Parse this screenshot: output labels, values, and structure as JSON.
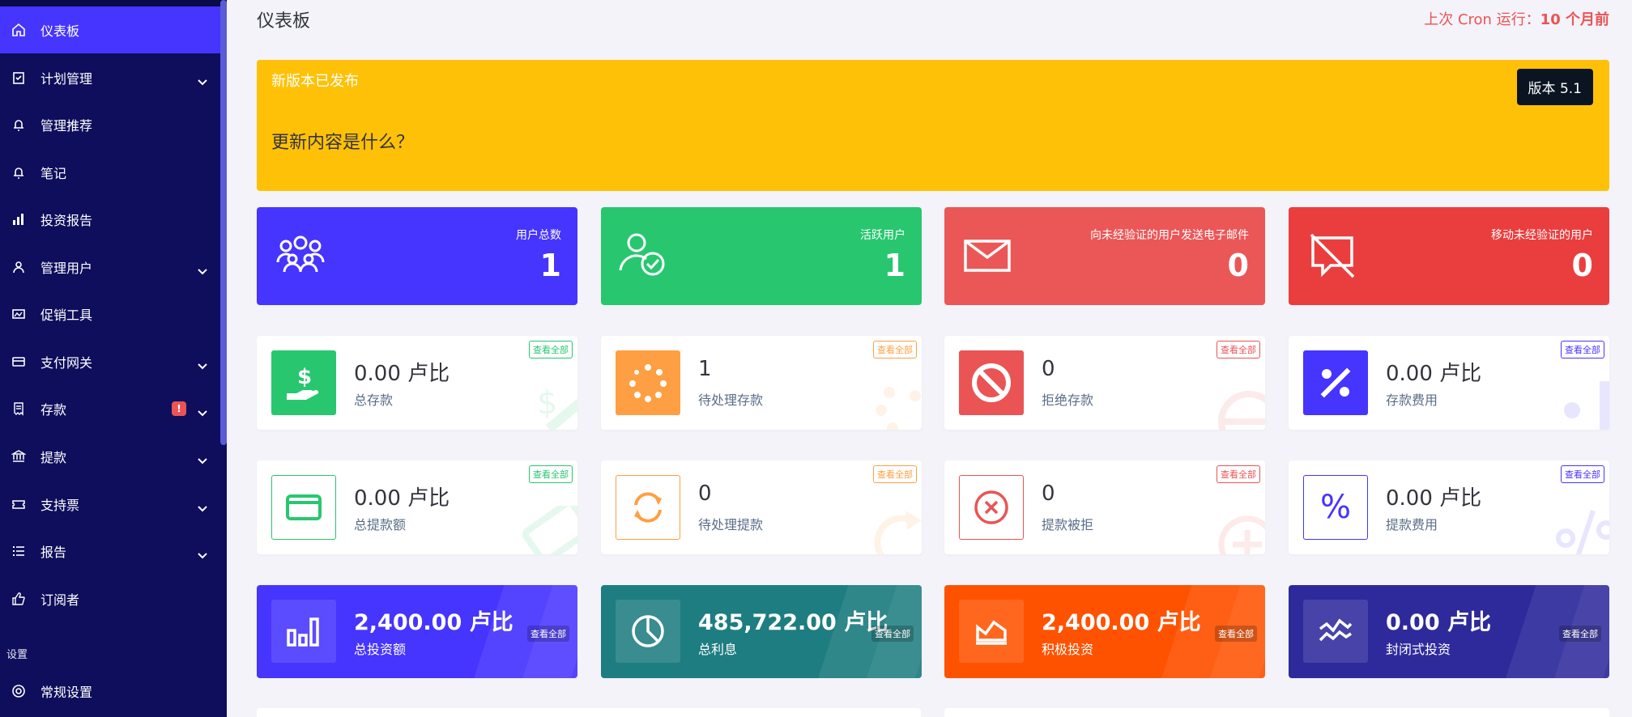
{
  "sidebar": {
    "items": [
      {
        "label": "仪表板",
        "icon": "home-icon",
        "active": true
      },
      {
        "label": "计划管理",
        "icon": "clipboard-icon",
        "chevron": true
      },
      {
        "label": "管理推荐",
        "icon": "bell-icon"
      },
      {
        "label": "笔记",
        "icon": "bell-icon"
      },
      {
        "label": "投资报告",
        "icon": "bar-chart-icon"
      },
      {
        "label": "管理用户",
        "icon": "users-icon",
        "chevron": true
      },
      {
        "label": "促销工具",
        "icon": "image-icon"
      },
      {
        "label": "支付网关",
        "icon": "credit-card-icon",
        "chevron": true
      },
      {
        "label": "存款",
        "icon": "receipt-icon",
        "chevron": true,
        "badge": "!"
      },
      {
        "label": "提款",
        "icon": "bank-icon",
        "chevron": true
      },
      {
        "label": "支持票",
        "icon": "ticket-icon",
        "chevron": true
      },
      {
        "label": "报告",
        "icon": "list-icon",
        "chevron": true
      },
      {
        "label": "订阅者",
        "icon": "thumbs-up-icon"
      }
    ],
    "section_title": "设置",
    "settings_item": {
      "label": "常规设置",
      "icon": "lifebuoy-icon"
    }
  },
  "header": {
    "title": "仪表板",
    "cron_prefix": "上次 Cron 运行：",
    "cron_value": "10 个月前"
  },
  "banner": {
    "title": "新版本已发布",
    "subtitle": "更新内容是什么？",
    "version": "版本 5.1",
    "color": "#ffc107"
  },
  "stat_cards": [
    {
      "label": "用户总数",
      "value": "1",
      "color": "#4634ff",
      "icon": "users-group-icon"
    },
    {
      "label": "活跃用户",
      "value": "1",
      "color": "#28c76f",
      "icon": "user-check-icon"
    },
    {
      "label": "向未经验证的用户发送电子邮件",
      "value": "0",
      "color": "#eb5757",
      "icon": "envelope-icon"
    },
    {
      "label": "移动未经验证的用户",
      "value": "0",
      "color": "#ea3e3e",
      "icon": "no-mobile-icon"
    }
  ],
  "view_all": "查看全部",
  "deposit_cards": [
    {
      "value": "0.00 卢比",
      "label": "总存款",
      "color": "#28c76f",
      "icon": "hand-dollar-icon"
    },
    {
      "value": "1",
      "label": "待处理存款",
      "color": "#ff9f43",
      "icon": "spinner-icon"
    },
    {
      "value": "0",
      "label": "拒绝存款",
      "color": "#ea5455",
      "icon": "ban-icon"
    },
    {
      "value": "0.00 卢比",
      "label": "存款费用",
      "color": "#4634ff",
      "icon": "percent-icon"
    }
  ],
  "withdraw_cards": [
    {
      "value": "0.00 卢比",
      "label": "总提款额",
      "color": "#28c76f",
      "icon": "credit-card-icon"
    },
    {
      "value": "0",
      "label": "待处理提款",
      "color": "#ff9f43",
      "icon": "sync-icon"
    },
    {
      "value": "0",
      "label": "提款被拒",
      "color": "#ea5455",
      "icon": "times-circle-icon"
    },
    {
      "value": "0.00 卢比",
      "label": "提款费用",
      "color": "#4634ff",
      "icon": "percent-icon"
    }
  ],
  "invest_cards": [
    {
      "value": "2,400.00 卢比",
      "label": "总投资额",
      "color": "#4634ff",
      "icon": "chart-bar-icon"
    },
    {
      "value": "485,722.00 卢比",
      "label": "总利息",
      "color": "#1e7d80",
      "icon": "pie-chart-icon"
    },
    {
      "value": "2,400.00 卢比",
      "label": "积极投资",
      "color": "#ff5200",
      "icon": "area-chart-icon"
    },
    {
      "value": "0.00 卢比",
      "label": "封闭式投资",
      "color": "#2e2a9c",
      "icon": "wave-chart-icon"
    }
  ]
}
